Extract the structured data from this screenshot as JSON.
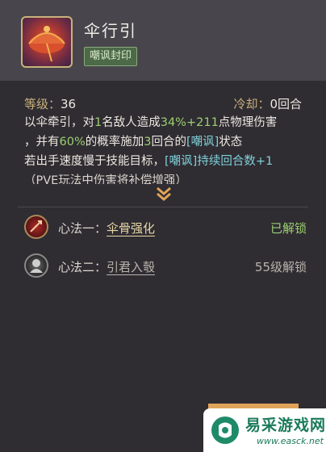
{
  "skill": {
    "name": "伞行引",
    "tag": "嘲讽封印",
    "level_label": "等级：",
    "level_value": "36",
    "cooldown_label": "冷却：",
    "cooldown_value": "0回合"
  },
  "description": {
    "line1": [
      "以伞牵引，对",
      "1",
      "名敌人造成",
      "34%+211",
      "点物理伤害"
    ],
    "line2": [
      "，并有",
      "60%",
      "的概率施加",
      "3",
      "回合的",
      "[嘲讽]",
      "状态"
    ],
    "line3": [
      "若出手速度慢于技能目标，",
      "[嘲讽]持续回合数+1"
    ],
    "line4": "（PVE玩法中伤害将补偿增强）"
  },
  "hearts": [
    {
      "label": "心法一：",
      "name": "伞骨强化",
      "status": "已解锁",
      "icon": "red-emblem-icon",
      "status_color": "#9bd16f",
      "name_color": "#e8d9a8"
    },
    {
      "label": "心法二：",
      "name": "引君入彀",
      "status": "55级解锁",
      "icon": "gray-portrait-icon",
      "status_color": "#b8b4ac",
      "name_color": "#b8b4ac"
    }
  ],
  "watermark": {
    "title": "易采游戏网",
    "url": "www.easck.net"
  }
}
